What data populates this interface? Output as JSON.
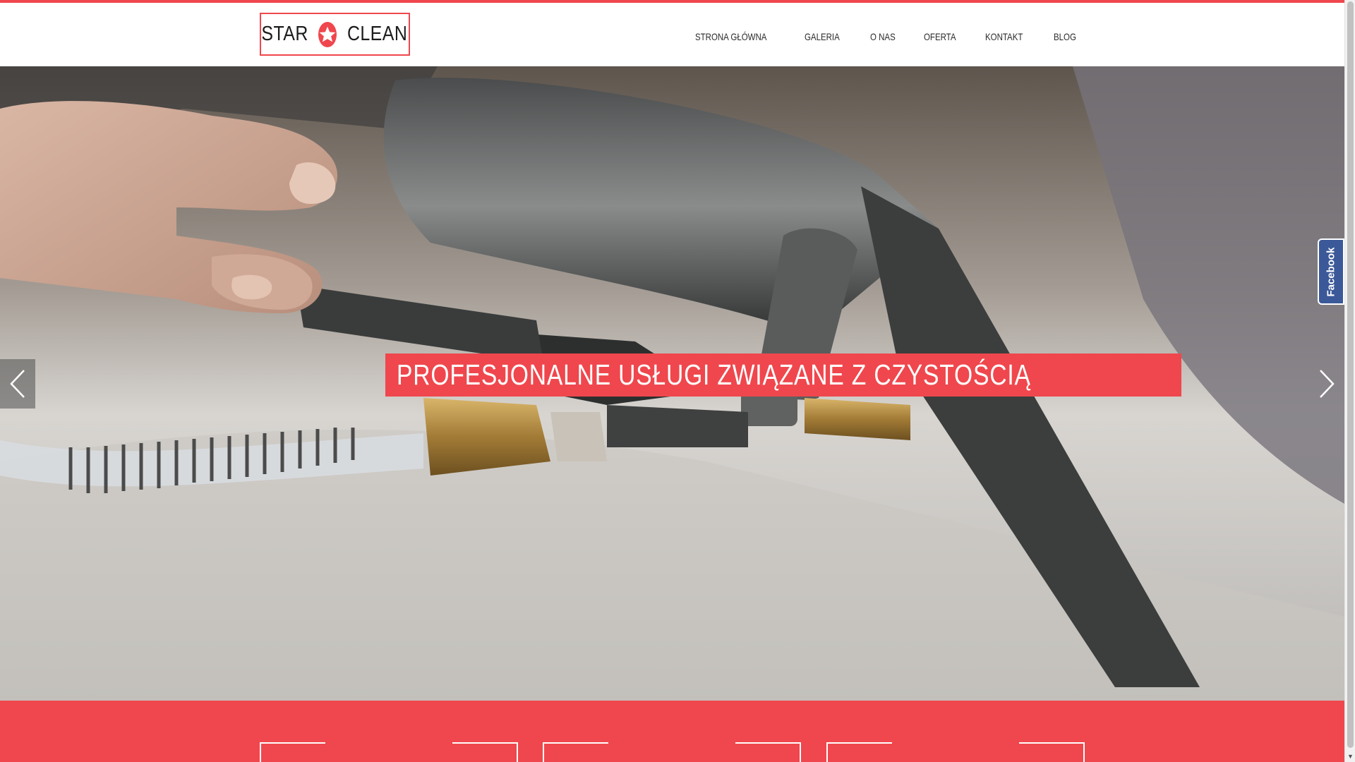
{
  "brand": {
    "logo_left": "STAR",
    "logo_right": "CLEAN",
    "accent_color": "#ef474d",
    "icon": "star-icon"
  },
  "nav": {
    "items": [
      {
        "label": "STRONA GŁÓWNA"
      },
      {
        "label": "GALERIA"
      },
      {
        "label": "O NAS"
      },
      {
        "label": "OFERTA"
      },
      {
        "label": "KONTAKT"
      },
      {
        "label": "BLOG"
      }
    ]
  },
  "hero": {
    "headline": "PROFESJONALNE USŁUGI ZWIĄZANE Z CZYSTOŚCIĄ",
    "image": "upholstery-cleaning-photo",
    "prev_icon": "chevron-left-icon",
    "next_icon": "chevron-right-icon"
  },
  "social": {
    "facebook_label": "Facebook",
    "facebook_color": "#3b5998"
  },
  "features": {
    "count": 3,
    "background": "#ef474d"
  }
}
